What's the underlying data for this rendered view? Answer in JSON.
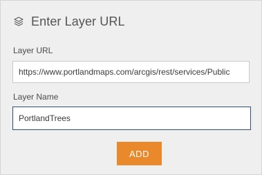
{
  "dialog": {
    "title": "Enter Layer URL",
    "icon": "layers-icon"
  },
  "layer_url": {
    "label": "Layer URL",
    "value": "https://www.portlandmaps.com/arcgis/rest/services/Public"
  },
  "layer_name": {
    "label": "Layer Name",
    "value": "PortlandTrees"
  },
  "add_button": {
    "label": "ADD",
    "color": "#e9892c"
  }
}
